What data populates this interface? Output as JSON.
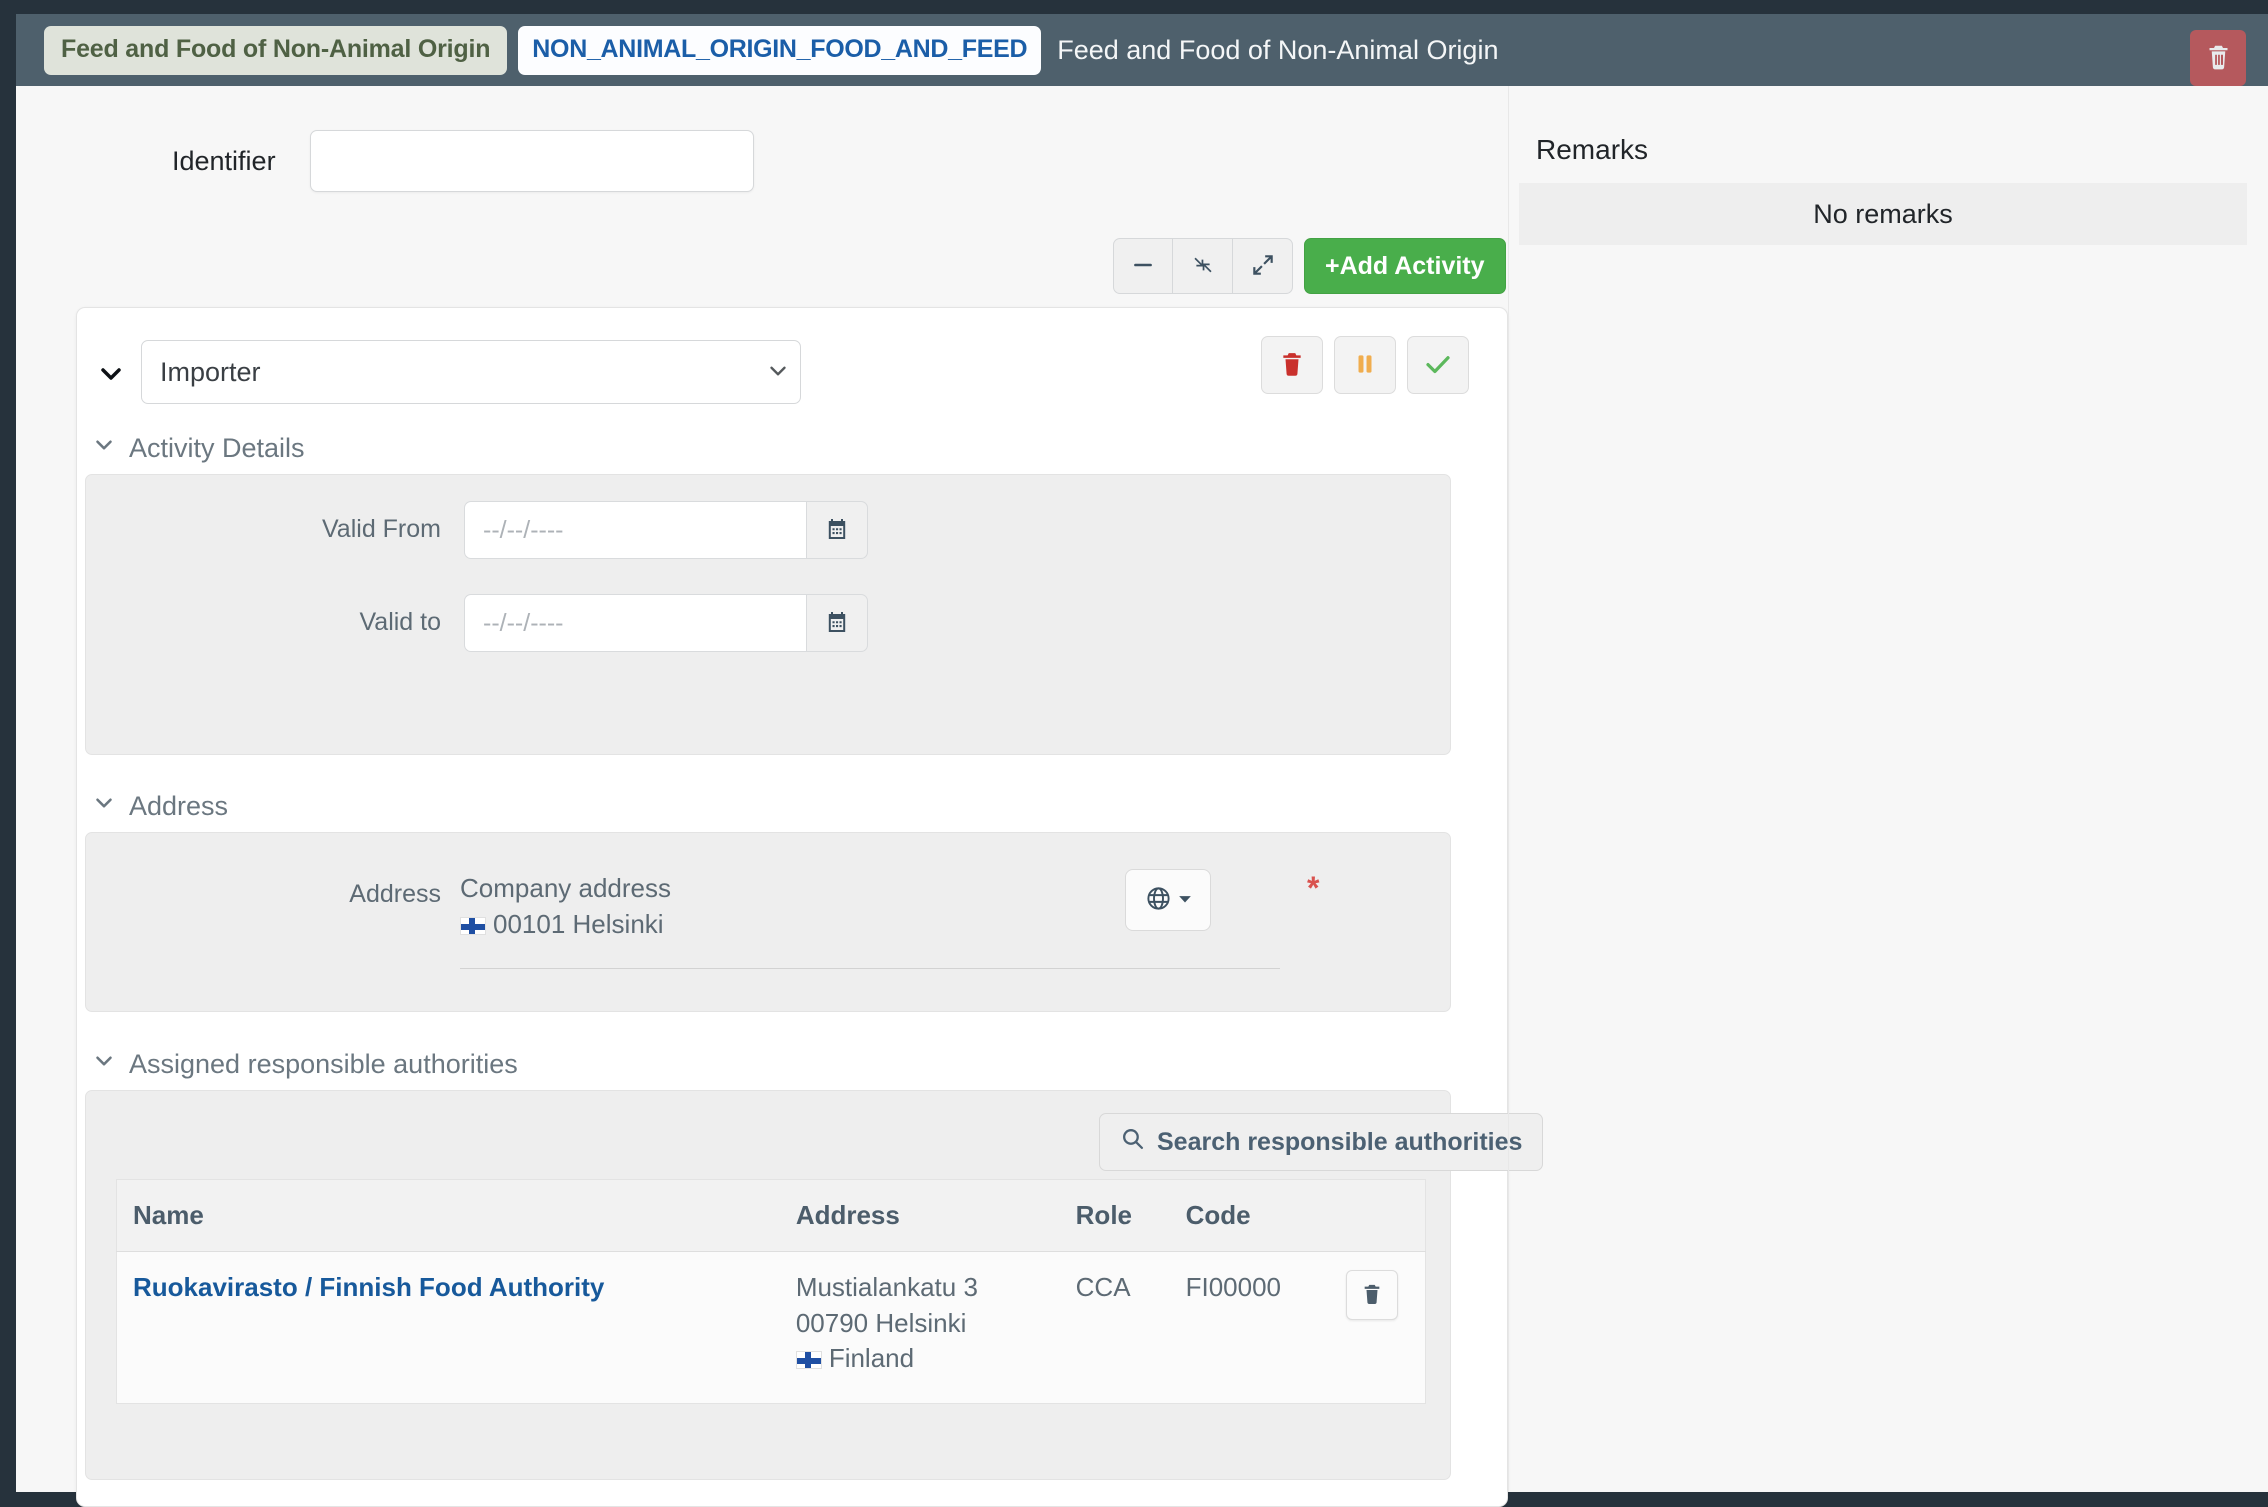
{
  "header": {
    "activity_badge": "Feed and Food of Non-Animal Origin",
    "code_badge": "NON_ANIMAL_ORIGIN_FOOD_AND_FEED",
    "title": "Feed and Food of Non-Animal Origin",
    "delete_icon": "trash-icon"
  },
  "toolbar": {
    "identifier_label": "Identifier",
    "identifier_value": "",
    "identifier_placeholder": "",
    "collapse_all_icon": "minus-icon",
    "compress_icon": "compress-arrows-icon",
    "expand_icon": "expand-arrows-icon",
    "add_activity_label": "+Add Activity"
  },
  "activity": {
    "role_selected": "Importer",
    "role_options": [
      "Importer"
    ],
    "actions": {
      "delete_icon": "trash-icon",
      "suspend_icon": "pause-icon",
      "validate_icon": "check-icon"
    },
    "details": {
      "section_title": "Activity Details",
      "valid_from_label": "Valid From",
      "valid_from_value": "",
      "valid_from_placeholder": "--/--/----",
      "valid_to_label": "Valid to",
      "valid_to_value": "",
      "valid_to_placeholder": "--/--/----",
      "calendar_icon": "calendar-icon"
    },
    "address": {
      "section_title": "Address",
      "field_label": "Address",
      "line1": "Company address",
      "line2": "00101 Helsinki",
      "country_flag": "finland-flag-icon",
      "globe_icon": "globe-icon",
      "required_marker": "*"
    },
    "authorities": {
      "section_title": "Assigned responsible authorities",
      "search_button_label": "Search responsible authorities",
      "search_icon": "search-icon",
      "columns": [
        "Name",
        "Address",
        "Role",
        "Code"
      ],
      "rows": [
        {
          "name": "Ruokavirasto / Finnish Food Authority",
          "address_line1": "Mustialankatu 3",
          "address_line2": "00790 Helsinki",
          "address_country": "Finland",
          "role": "CCA",
          "code": "FI00000",
          "delete_icon": "trash-icon"
        }
      ]
    }
  },
  "remarks": {
    "title": "Remarks",
    "empty_text": "No remarks"
  },
  "colors": {
    "header_bar": "#4e606c",
    "left_rail": "#26323c",
    "accent_green": "#49ae4b",
    "danger_red": "#b5595d",
    "link_blue": "#17599b",
    "badge_green_text": "#4f6144",
    "badge_code_text": "#1b5ea8"
  }
}
